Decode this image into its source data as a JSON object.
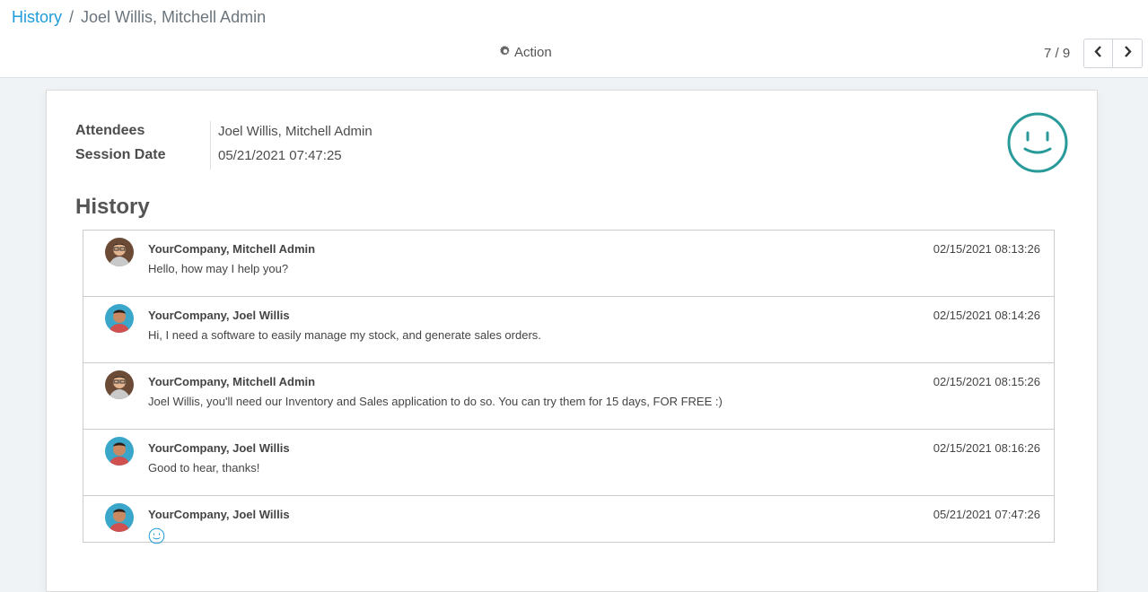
{
  "breadcrumb": {
    "parent": "History",
    "separator": "/",
    "current": "Joel Willis, Mitchell Admin"
  },
  "toolbar": {
    "action_label": "Action",
    "action_icon": "gear-icon"
  },
  "pager": {
    "value": "7 / 9",
    "prev_icon": "chevron-left-icon",
    "next_icon": "chevron-right-icon"
  },
  "form": {
    "attendees_label": "Attendees",
    "attendees_value": "Joel Willis, Mitchell Admin",
    "session_date_label": "Session Date",
    "session_date_value": "05/21/2021 07:47:25",
    "rating_icon": "smiley-face-icon",
    "accent_color": "#299a9a"
  },
  "history": {
    "title": "History",
    "messages": [
      {
        "author": "YourCompany, Mitchell Admin",
        "date": "02/15/2021 08:13:26",
        "body": "Hello, how may I help you?",
        "avatar": "mitchell-avatar"
      },
      {
        "author": "YourCompany, Joel Willis",
        "date": "02/15/2021 08:14:26",
        "body": "Hi, I need a software to easily manage my stock, and generate sales orders.",
        "avatar": "joel-avatar"
      },
      {
        "author": "YourCompany, Mitchell Admin",
        "date": "02/15/2021 08:15:26",
        "body": "Joel Willis, you'll need our Inventory and Sales application to do so. You can try them for 15 days, FOR FREE :)",
        "avatar": "mitchell-avatar"
      },
      {
        "author": "YourCompany, Joel Willis",
        "date": "02/15/2021 08:16:26",
        "body": "Good to hear, thanks!",
        "avatar": "joel-avatar"
      },
      {
        "author": "YourCompany, Joel Willis",
        "date": "05/21/2021 07:47:26",
        "body_icon": "smiley-face-icon",
        "avatar": "joel-avatar"
      }
    ]
  },
  "colors": {
    "link": "#1f9cd9",
    "smiley": "#299a9a",
    "small_smiley": "#1f9cd9"
  }
}
